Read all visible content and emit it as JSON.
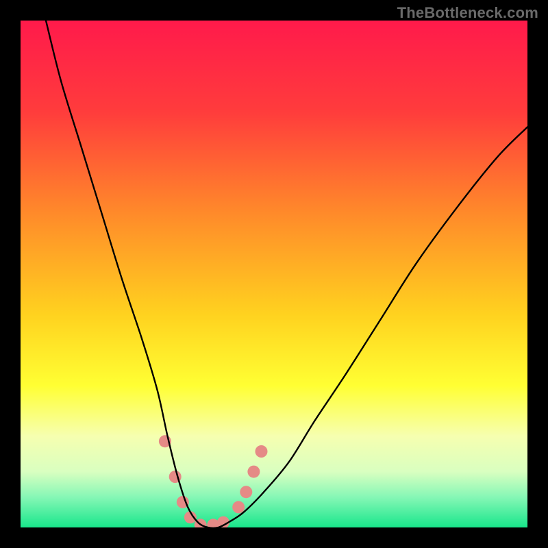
{
  "watermark": {
    "text": "TheBottleneck.com"
  },
  "chart_data": {
    "type": "line",
    "title": "",
    "xlabel": "",
    "ylabel": "",
    "xlim": [
      0,
      100
    ],
    "ylim": [
      0,
      100
    ],
    "grid": false,
    "legend": false,
    "gradient_stops": [
      {
        "offset": 0.0,
        "color": "#ff1a4b"
      },
      {
        "offset": 0.18,
        "color": "#ff3c3c"
      },
      {
        "offset": 0.38,
        "color": "#ff8a2a"
      },
      {
        "offset": 0.58,
        "color": "#ffd21f"
      },
      {
        "offset": 0.72,
        "color": "#ffff33"
      },
      {
        "offset": 0.82,
        "color": "#f6ffb0"
      },
      {
        "offset": 0.89,
        "color": "#d9ffc0"
      },
      {
        "offset": 0.94,
        "color": "#86f7b6"
      },
      {
        "offset": 1.0,
        "color": "#18e68b"
      }
    ],
    "series": [
      {
        "name": "bottleneck-curve",
        "color": "#000000",
        "x": [
          5,
          8,
          12,
          16,
          20,
          24,
          27,
          29,
          31,
          33,
          35,
          37,
          39,
          41,
          44,
          48,
          53,
          58,
          64,
          71,
          78,
          86,
          94,
          100
        ],
        "y": [
          100,
          88,
          75,
          62,
          49,
          37,
          27,
          18,
          10,
          4,
          1,
          0,
          0,
          1,
          3,
          7,
          13,
          21,
          30,
          41,
          52,
          63,
          73,
          79
        ]
      }
    ],
    "markers": {
      "name": "highlight-points",
      "color": "#e58a86",
      "radius_px": 9,
      "points": [
        {
          "x": 28.5,
          "y": 17
        },
        {
          "x": 30.5,
          "y": 10
        },
        {
          "x": 32.0,
          "y": 5
        },
        {
          "x": 33.5,
          "y": 2
        },
        {
          "x": 35.5,
          "y": 0.5
        },
        {
          "x": 38.0,
          "y": 0.5
        },
        {
          "x": 40.0,
          "y": 1
        },
        {
          "x": 43.0,
          "y": 4
        },
        {
          "x": 44.5,
          "y": 7
        },
        {
          "x": 46.0,
          "y": 11
        },
        {
          "x": 47.5,
          "y": 15
        }
      ]
    }
  }
}
